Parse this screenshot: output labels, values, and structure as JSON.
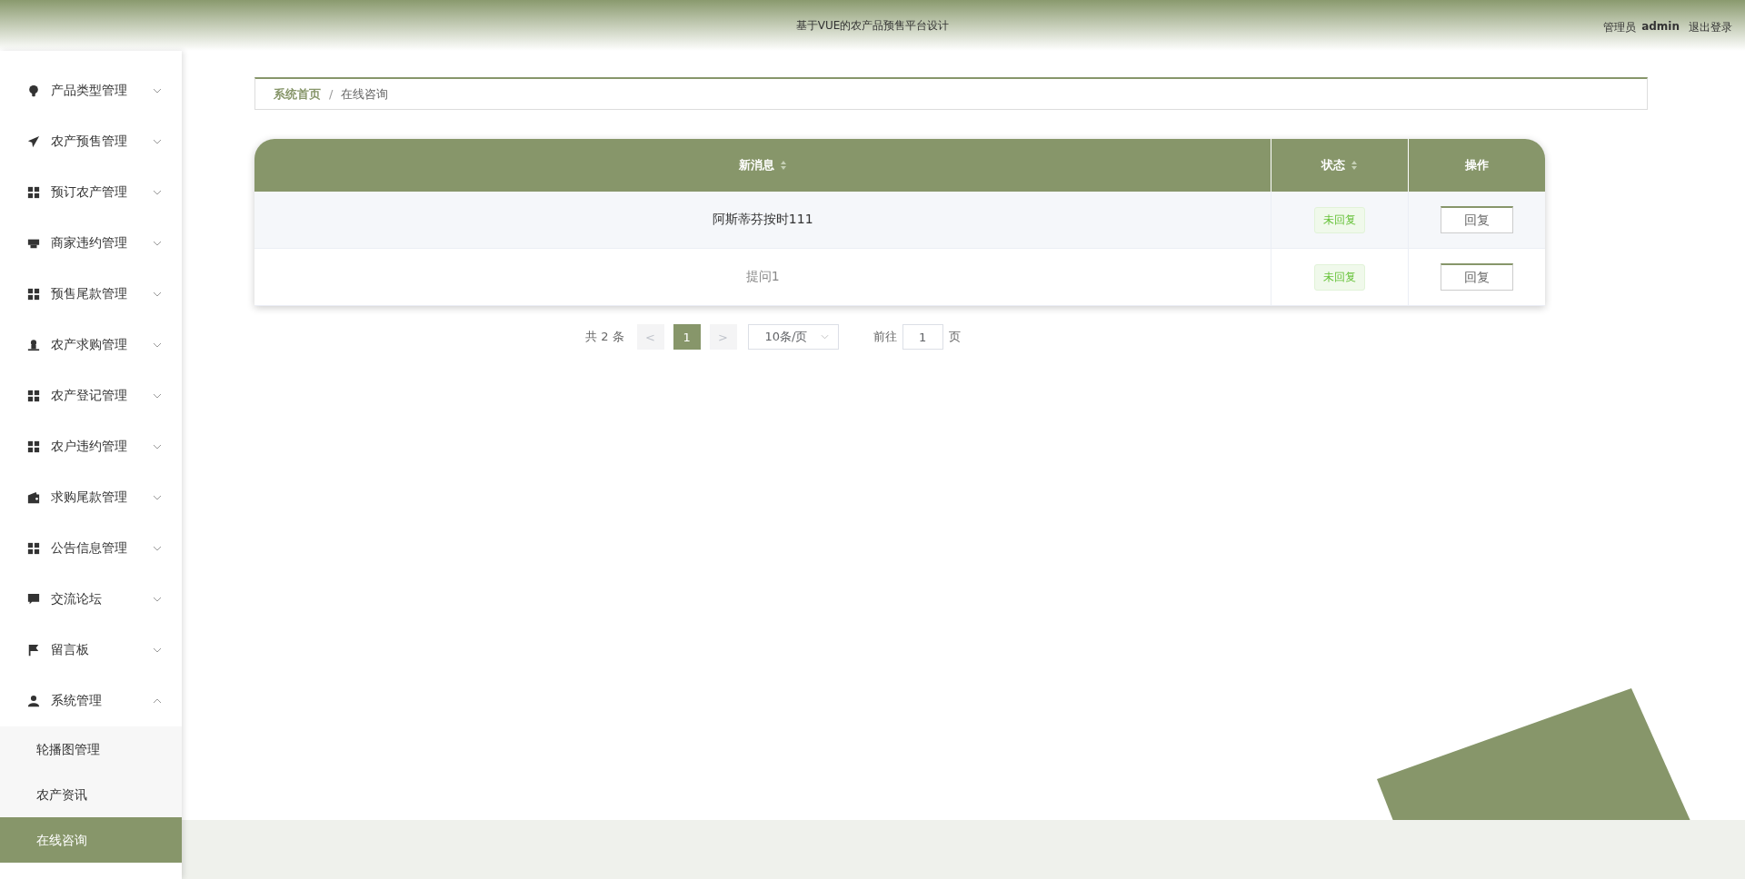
{
  "header": {
    "title": "基于VUE的农产品预售平台设计",
    "user_role": "管理员",
    "user_name": "admin",
    "logout": "退出登录"
  },
  "sidebar": {
    "items": [
      {
        "label": "产品类型管理",
        "expanded": false
      },
      {
        "label": "农产预售管理",
        "expanded": false
      },
      {
        "label": "预订农产管理",
        "expanded": false
      },
      {
        "label": "商家违约管理",
        "expanded": false
      },
      {
        "label": "预售尾款管理",
        "expanded": false
      },
      {
        "label": "农产求购管理",
        "expanded": false
      },
      {
        "label": "农产登记管理",
        "expanded": false
      },
      {
        "label": "农户违约管理",
        "expanded": false
      },
      {
        "label": "求购尾款管理",
        "expanded": false
      },
      {
        "label": "公告信息管理",
        "expanded": false
      },
      {
        "label": "交流论坛",
        "expanded": false
      },
      {
        "label": "留言板",
        "expanded": false
      },
      {
        "label": "系统管理",
        "expanded": true,
        "children": [
          {
            "label": "轮播图管理",
            "selected": false
          },
          {
            "label": "农产资讯",
            "selected": false
          },
          {
            "label": "在线咨询",
            "selected": true
          }
        ]
      }
    ]
  },
  "breadcrumb": {
    "separator": "/",
    "items": [
      "系统首页",
      "在线咨询"
    ]
  },
  "table": {
    "columns": [
      {
        "label": "新消息",
        "sortable": true
      },
      {
        "label": "状态",
        "sortable": true
      },
      {
        "label": "操作",
        "sortable": false
      }
    ],
    "rows": [
      {
        "message": "阿斯蒂芬按时111",
        "status": "未回复",
        "action": "回复",
        "hovered": true
      },
      {
        "message": "提问1",
        "status": "未回复",
        "action": "回复",
        "hovered": false
      }
    ]
  },
  "pagination": {
    "total": "共 2 条",
    "prev": "<",
    "pages": [
      {
        "label": "1",
        "selected": true
      }
    ],
    "next": ">",
    "page_size": "10条/页",
    "goto_label": "前往",
    "goto_value": "1",
    "goto_suffix": "页"
  }
}
